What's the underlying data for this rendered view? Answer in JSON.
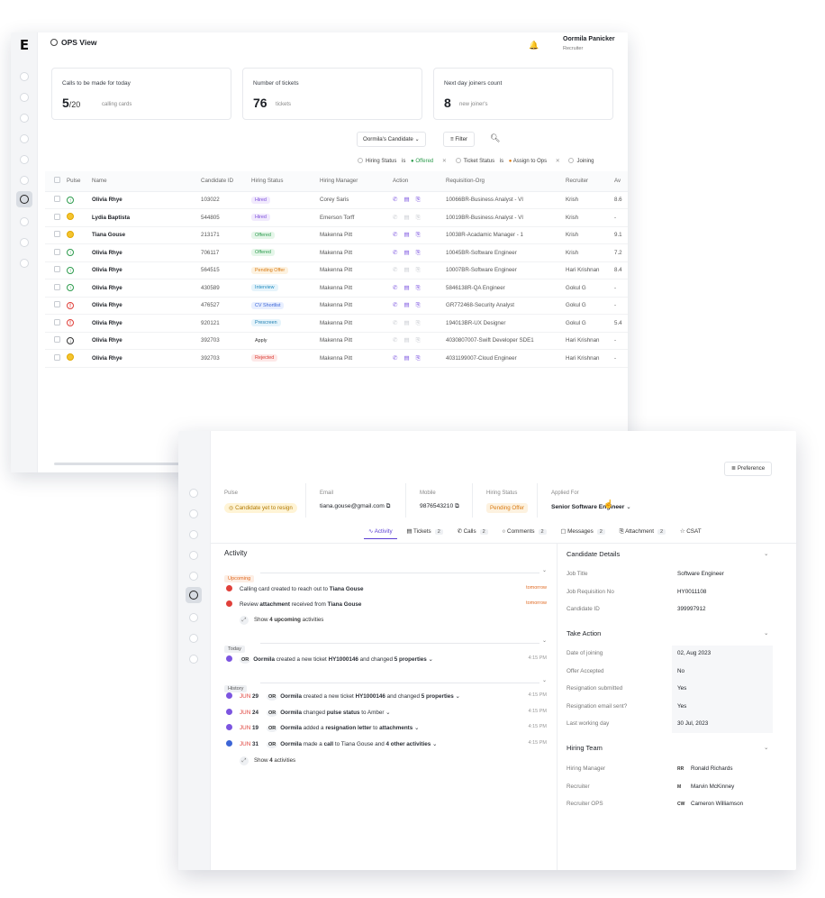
{
  "ops": {
    "title": "OPS View",
    "user": {
      "name": "Oormila Panicker",
      "role": "Recruiter"
    },
    "cards": [
      {
        "label": "Calls to be made for today",
        "value": "5",
        "suffix": "/20",
        "unit": "calling cards"
      },
      {
        "label": "Number of tickets",
        "value": "76",
        "suffix": "",
        "unit": "tickets"
      },
      {
        "label": "Next day joiners count",
        "value": "8",
        "suffix": "",
        "unit": "new joiner's"
      }
    ],
    "candidate_dropdown": "Oormila's Candidate",
    "filter_label": "Filter",
    "chips": {
      "hiring_status": "Hiring Status",
      "is1": "is",
      "offered": "Offered",
      "ticket_status": "Ticket Status",
      "is2": "is",
      "assign": "Assign to Ops",
      "joining": "Joining"
    },
    "columns": [
      "Pulse",
      "Name",
      "Candidate ID",
      "Hiring Status",
      "Hiring Manager",
      "Action",
      "Requisition-Org",
      "Recruiter",
      "Av"
    ],
    "rows": [
      {
        "pulse": "green",
        "name": "Olivia Rhye",
        "id": "103022",
        "status": "Hired",
        "status_key": "Hired",
        "manager": "Corey Saris",
        "action_on": true,
        "req": "10066BR-Business Analyst - VI",
        "recruiter": "Krish",
        "av": "8.6"
      },
      {
        "pulse": "yellow",
        "name": "Lydia Baptista",
        "id": "544805",
        "status": "Hired",
        "status_key": "Hired",
        "manager": "Emerson Torff",
        "action_on": false,
        "req": "10019BR-Business Analyst - VI",
        "recruiter": "Krish",
        "av": "-"
      },
      {
        "pulse": "yellow",
        "name": "Tiana Gouse",
        "id": "213171",
        "status": "Offered",
        "status_key": "Offered",
        "manager": "Makenna Pitt",
        "action_on": true,
        "req": "10038R-Acadamic Manager - 1",
        "recruiter": "Krish",
        "av": "9.1"
      },
      {
        "pulse": "green",
        "name": "Olivia Rhye",
        "id": "706117",
        "status": "Offered",
        "status_key": "Offered",
        "manager": "Makenna Pitt",
        "action_on": true,
        "req": "10045BR-Software Engineer",
        "recruiter": "Krish",
        "av": "7.2"
      },
      {
        "pulse": "green",
        "name": "Olivia Rhye",
        "id": "564515",
        "status": "Pending Offer",
        "status_key": "PendingOffer",
        "manager": "Makenna Pitt",
        "action_on": false,
        "req": "10007BR-Software Engineer",
        "recruiter": "Hari Krishnan",
        "av": "8.4"
      },
      {
        "pulse": "green",
        "name": "Olivia Rhye",
        "id": "430589",
        "status": "Interview",
        "status_key": "Interview",
        "manager": "Makenna Pitt",
        "action_on": true,
        "req": "5846138R-QA Engineer",
        "recruiter": "Gokul G",
        "av": "-"
      },
      {
        "pulse": "red",
        "name": "Olivia Rhye",
        "id": "476527",
        "status": "CV Shortlist",
        "status_key": "CVShortlist",
        "manager": "Makenna Pitt",
        "action_on": true,
        "req": "GR772468-Security Analyst",
        "recruiter": "Gokul G",
        "av": "-"
      },
      {
        "pulse": "red",
        "name": "Olivia Rhye",
        "id": "920121",
        "status": "Prescreen",
        "status_key": "Prescreen",
        "manager": "Makenna Pitt",
        "action_on": false,
        "req": "194013BR-UX Designer",
        "recruiter": "Gokul G",
        "av": "5.4"
      },
      {
        "pulse": "dark",
        "name": "Olivia Rhye",
        "id": "392703",
        "status": "Apply",
        "status_key": "Apply",
        "manager": "Makenna Pitt",
        "action_on": false,
        "req": "4030807007-Swift Developer SDE1",
        "recruiter": "Hari Krishnan",
        "av": "-"
      },
      {
        "pulse": "yellow",
        "name": "Olivia Rhye",
        "id": "392703",
        "status": "Rejected",
        "status_key": "Rejected",
        "manager": "Makenna Pitt",
        "action_on": true,
        "req": "4031199007-Cloud Engineer",
        "recruiter": "Hari Krishnan",
        "av": "-"
      }
    ]
  },
  "detail": {
    "preference": "Preference",
    "info": {
      "pulse_k": "Pulse",
      "pulse_v": "Candidate yet to resign",
      "email_k": "Email",
      "email_v": "tiana.gouse@gmail.com",
      "mobile_k": "Mobile",
      "mobile_v": "9876543210",
      "status_k": "Hiring Status",
      "status_v": "Pending Offer",
      "applied_k": "Applied For",
      "applied_v": "Senior Software Engineer"
    },
    "tabs": [
      {
        "label": "Activity",
        "count": ""
      },
      {
        "label": "Tickets",
        "count": "2"
      },
      {
        "label": "Calls",
        "count": "2"
      },
      {
        "label": "Comments",
        "count": "2"
      },
      {
        "label": "Messages",
        "count": "2"
      },
      {
        "label": "Attachment",
        "count": "2"
      },
      {
        "label": "CSAT",
        "count": ""
      }
    ],
    "activity_title": "Activity",
    "upcoming_label": "Upcoming",
    "today_label": "Today",
    "history_label": "History",
    "upcoming": [
      {
        "pre": "Calling card created to reach out to ",
        "b1": "Tiana Gouse",
        "mid": "",
        "b2": "",
        "time": "tomorrow"
      },
      {
        "pre": "Review ",
        "b1": "attachment",
        "mid": " received from ",
        "b2": "Tiana Gouse",
        "time": "tomorrow"
      }
    ],
    "upcoming_show": {
      "pre": "Show ",
      "count": "4 upcoming",
      "post": " activities"
    },
    "today": {
      "av": "OR",
      "who": "Oormila",
      "a": " created a new ticket ",
      "t": "HY1000146",
      "b": " and changed ",
      "c": "5 properties",
      "time": "4:15 PM"
    },
    "history": [
      {
        "month": "JUN",
        "day": "29",
        "av": "OR",
        "who": "Oormila",
        "a": " created a new ticket ",
        "b1": "HY1000146",
        "b": " and changed ",
        "b2": "5 properties",
        "time": "4:15 PM"
      },
      {
        "month": "JUN",
        "day": "24",
        "av": "OR",
        "who": "Oormila",
        "a": " changed ",
        "b1": "pulse status",
        "b": " to Amber",
        "b2": "",
        "time": "4:15 PM"
      },
      {
        "month": "JUN",
        "day": "19",
        "av": "OR",
        "who": "Oormila",
        "a": " added a ",
        "b1": "resignation letter",
        "b": " to ",
        "b2": "attachments",
        "time": "4:15 PM"
      },
      {
        "month": "JUN",
        "day": "31",
        "av": "OR",
        "who": "Oormila",
        "a": " made a ",
        "b1": "call",
        "b": " to Tiana Gouse and ",
        "b2": "4 other activities",
        "time": "4:15 PM"
      }
    ],
    "history_show": {
      "pre": "Show ",
      "count": "4",
      "post": " activities"
    },
    "candidate_details": {
      "title": "Candidate Details",
      "items": [
        {
          "k": "Job Title",
          "v": "Software Engineer"
        },
        {
          "k": "Job Requisition No",
          "v": "HY0011108"
        },
        {
          "k": "Candidate ID",
          "v": "399997912"
        }
      ]
    },
    "take_action": {
      "title": "Take Action",
      "items": [
        {
          "k": "Date of joining",
          "v": "02, Aug 2023"
        },
        {
          "k": "Offer Accepted",
          "v": "No"
        },
        {
          "k": "Resignation submitted",
          "v": "Yes"
        },
        {
          "k": "Resignation email sent?",
          "v": "Yes"
        },
        {
          "k": "Last working day",
          "v": "30 Jul, 2023"
        }
      ]
    },
    "hiring_team": {
      "title": "Hiring Team",
      "items": [
        {
          "k": "Hiring Manager",
          "ini": "RR",
          "v": "Ronald Richards"
        },
        {
          "k": "Recruiter",
          "ini": "M",
          "v": "Marvin McKinney"
        },
        {
          "k": "Recruiter OPS",
          "ini": "CW",
          "v": "Cameron Williamson"
        }
      ]
    }
  }
}
